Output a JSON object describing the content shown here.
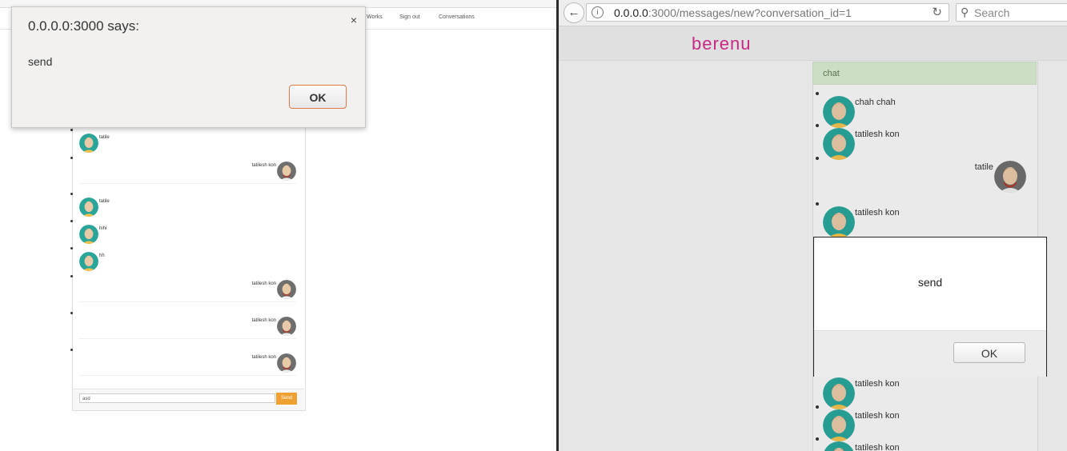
{
  "left": {
    "nav": {
      "items": [
        "ly Works",
        "Sign out",
        "Conversations"
      ]
    },
    "alert": {
      "title": "0.0.0.0:3000 says:",
      "message": "send",
      "ok_label": "OK",
      "close_glyph": "×"
    },
    "messages": [
      {
        "author": "tatile",
        "side": "left",
        "avatar": "woman"
      },
      {
        "author": "tatilesh kon",
        "side": "right",
        "avatar": "man"
      },
      {
        "author": "tatile",
        "side": "left",
        "avatar": "woman"
      },
      {
        "author": "hihi",
        "side": "left",
        "avatar": "woman"
      },
      {
        "author": "hh",
        "side": "left",
        "avatar": "woman"
      },
      {
        "author": "tatilesh kon",
        "side": "right",
        "avatar": "man"
      },
      {
        "author": "tatilesh kon",
        "side": "right",
        "avatar": "man"
      },
      {
        "author": "tatilesh kon",
        "side": "right",
        "avatar": "man"
      }
    ],
    "input": {
      "value": "asd"
    },
    "send_label": "Send"
  },
  "right": {
    "url": {
      "host": "0.0.0.0",
      "path": ":3000/messages/new?conversation_id=1"
    },
    "search": {
      "placeholder": "Search"
    },
    "logo": "berenu",
    "panel": {
      "title": "chat"
    },
    "messages": [
      {
        "author": "chah chah",
        "side": "left",
        "avatar": "woman"
      },
      {
        "author": "tatilesh kon",
        "side": "left",
        "avatar": "woman"
      },
      {
        "author": "tatile",
        "side": "right",
        "avatar": "man"
      },
      {
        "author": "tatilesh kon",
        "side": "left",
        "avatar": "woman"
      },
      {
        "author": "tatilesh kon",
        "side": "left",
        "avatar": "woman"
      },
      {
        "author": "tatilesh kon",
        "side": "left",
        "avatar": "woman"
      },
      {
        "author": "tatilesh kon",
        "side": "left",
        "avatar": "woman"
      }
    ],
    "alert": {
      "message": "send",
      "ok_label": "OK"
    }
  },
  "colors": {
    "accent_send": "#f0a030",
    "logo": "#d42a8c",
    "panel_head": "#d7ead0"
  }
}
